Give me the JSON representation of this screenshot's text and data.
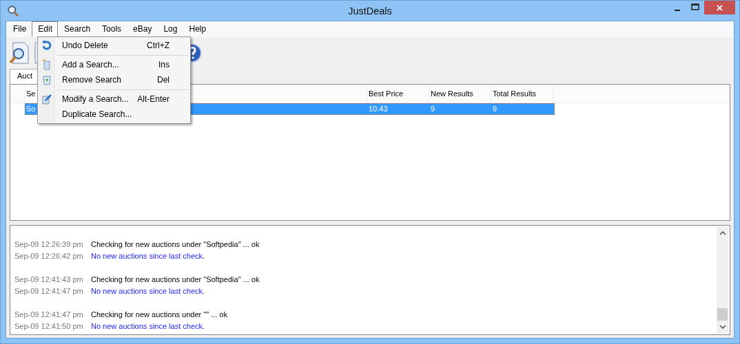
{
  "window": {
    "title": "JustDeals"
  },
  "menu": [
    {
      "label": "File",
      "selected": false
    },
    {
      "label": "Edit",
      "selected": true
    },
    {
      "label": "Search",
      "selected": false
    },
    {
      "label": "Tools",
      "selected": false
    },
    {
      "label": "eBay",
      "selected": false
    },
    {
      "label": "Log",
      "selected": false
    },
    {
      "label": "Help",
      "selected": false
    }
  ],
  "edit_menu": [
    {
      "kind": "item",
      "label": "Undo Delete",
      "shortcut": "Ctrl+Z"
    },
    {
      "kind": "separator"
    },
    {
      "kind": "item",
      "label": "Add a Search...",
      "shortcut": "Ins"
    },
    {
      "kind": "item",
      "label": "Remove Search",
      "shortcut": "Del"
    },
    {
      "kind": "separator"
    },
    {
      "kind": "item",
      "label": "Modify a Search...",
      "shortcut": "Alt-Enter"
    },
    {
      "kind": "item",
      "label": "Duplicate Search..."
    }
  ],
  "tabs": [
    {
      "label": "Auct",
      "selected": true
    }
  ],
  "table": {
    "columns": [
      "Se",
      "Best Price",
      "New Results",
      "Total Results"
    ],
    "rows": [
      {
        "cells": [
          "So",
          "10.43",
          "9",
          "9"
        ],
        "selected": true
      }
    ]
  },
  "log": {
    "groups": [
      {
        "entries": [
          {
            "time": "Sep-09 12:26:39 pm",
            "message": "Checking for new auctions under \"Softpedia\" ... ok",
            "kind": "status"
          },
          {
            "time": "Sep-09 12:26:42 pm",
            "message": "No new auctions since last check.",
            "kind": "result"
          }
        ]
      },
      {
        "entries": [
          {
            "time": "Sep-09 12:41:43 pm",
            "message": "Checking for new auctions under \"Softpedia\" ... ok",
            "kind": "status"
          },
          {
            "time": "Sep-09 12:41:47 pm",
            "message": "No new auctions since last check.",
            "kind": "result"
          }
        ]
      },
      {
        "entries": [
          {
            "time": "Sep-09 12:41:47 pm",
            "message": "Checking for new auctions under \"\" ... ok",
            "kind": "status"
          },
          {
            "time": "Sep-09 12:41:50 pm",
            "message": "No new auctions since last check.",
            "kind": "result"
          }
        ]
      }
    ]
  }
}
